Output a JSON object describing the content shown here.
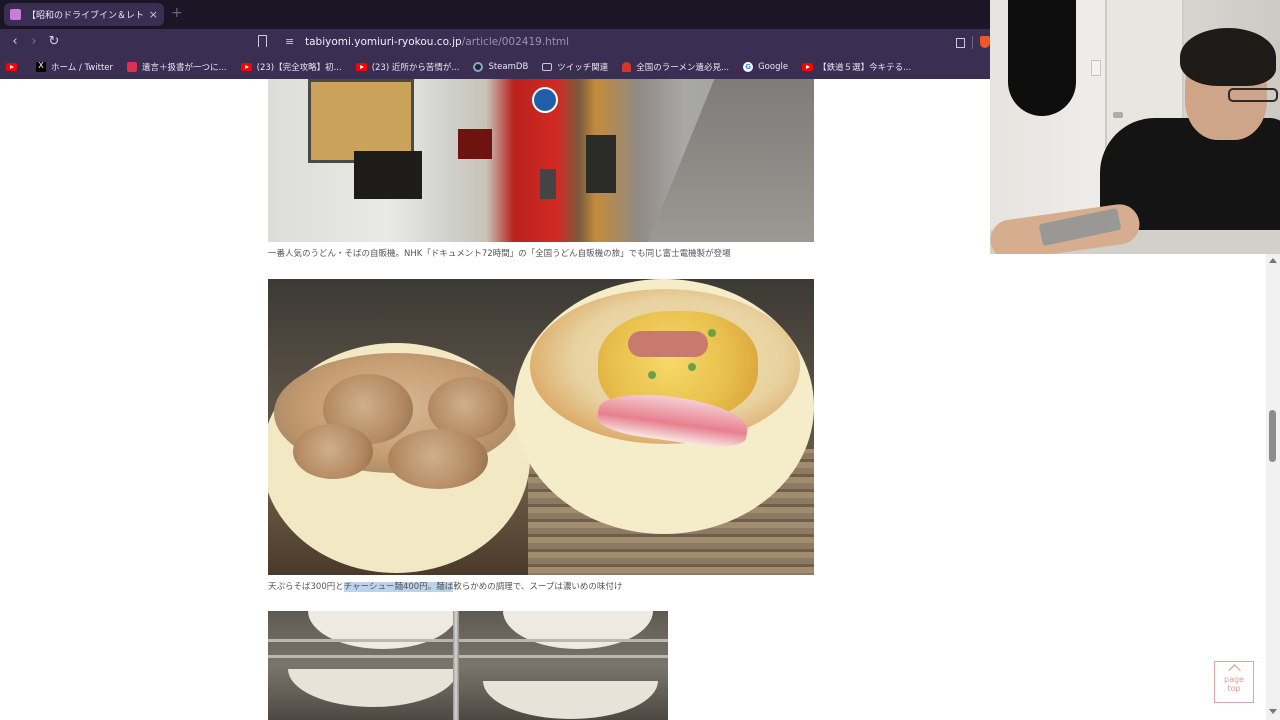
{
  "browser": {
    "tab": {
      "title": "【昭和のドライブイン＆レトロ自販機】",
      "close": "×"
    },
    "new_tab": "+",
    "url": {
      "host": "tabiyomi.yomiuri-ryokou.co.jp",
      "path": "/article/002419.html"
    },
    "bookmarks": [
      {
        "label": "",
        "icon": "youtube"
      },
      {
        "label": "ホーム / Twitter",
        "icon": "x"
      },
      {
        "label": "遺言＋扱書が一つに...",
        "icon": "red-app"
      },
      {
        "label": "(23)【完全攻略】初...",
        "icon": "youtube"
      },
      {
        "label": "(23) 近所から苦情が...",
        "icon": "youtube"
      },
      {
        "label": "SteamDB",
        "icon": "steam"
      },
      {
        "label": "ツイッチ関連",
        "icon": "folder"
      },
      {
        "label": "全国のラーメン遺必見...",
        "icon": "ramen"
      },
      {
        "label": "Google",
        "icon": "google"
      },
      {
        "label": "【鉄道５選】今キテる...",
        "icon": "youtube"
      }
    ]
  },
  "article": {
    "caption1": "一番人気のうどん・そばの自販機。NHK「ドキュメント72時間」の「全国うどん自販機の旅」でも同じ富士電機製が登場",
    "caption2": {
      "before": "天ぷらそば300円と",
      "selected": "チャーシュー麺400円。麺は",
      "after": "軟らかめの調理で、スープは濃いめの味付け"
    }
  },
  "page_top": {
    "line1": "page",
    "line2": "top"
  },
  "scrollbar": {
    "position_fraction": 0.36
  },
  "colors": {
    "chrome_dark": "#1b1626",
    "chrome": "#3a2e52",
    "selection": "#bcd3ee",
    "page_top_accent": "#e09b9b"
  }
}
